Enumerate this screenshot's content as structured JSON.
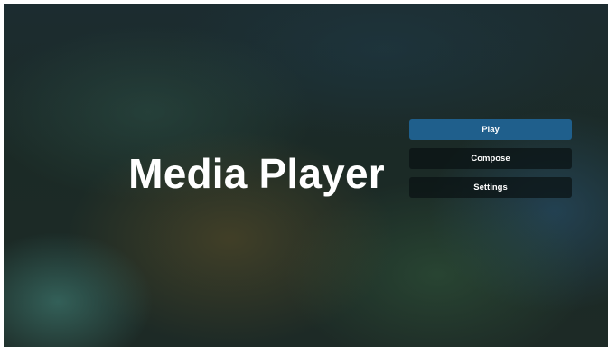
{
  "app": {
    "title": "Media Player"
  },
  "menu": {
    "items": [
      {
        "label": "Play",
        "selected": true
      },
      {
        "label": "Compose",
        "selected": false
      },
      {
        "label": "Settings",
        "selected": false
      }
    ]
  },
  "colors": {
    "selected_button": "#1f5f8c",
    "button": "#0a1214",
    "text": "#ffffff"
  }
}
